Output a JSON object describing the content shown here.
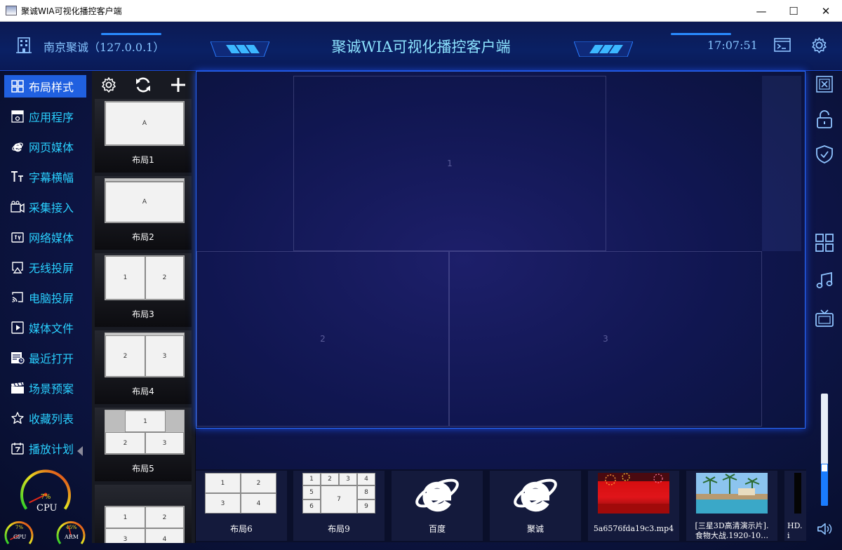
{
  "window": {
    "title": "聚诚WIA可视化播控客户端",
    "minimize": "—",
    "maximize": "☐",
    "close": "✕"
  },
  "header": {
    "company": "南京聚诚（127.0.0.1）",
    "title": "聚诚WIA可视化播控客户端",
    "clock": "17:07:51"
  },
  "nav": {
    "items": [
      {
        "label": "布局样式",
        "icon": "grid-icon",
        "active": true
      },
      {
        "label": "应用程序",
        "icon": "exe-icon"
      },
      {
        "label": "网页媒体",
        "icon": "ie-icon"
      },
      {
        "label": "字幕横幅",
        "icon": "text-icon"
      },
      {
        "label": "采集接入",
        "icon": "camera-icon"
      },
      {
        "label": "网络媒体",
        "icon": "tv-icon"
      },
      {
        "label": "无线投屏",
        "icon": "airplay-icon"
      },
      {
        "label": "电脑投屏",
        "icon": "cast-icon"
      },
      {
        "label": "媒体文件",
        "icon": "play-file-icon"
      },
      {
        "label": "最近打开",
        "icon": "recent-icon"
      },
      {
        "label": "场景预案",
        "icon": "clapper-icon"
      },
      {
        "label": "收藏列表",
        "icon": "star-icon"
      },
      {
        "label": "播放计划",
        "icon": "calendar-icon"
      }
    ]
  },
  "layouts": {
    "items": [
      {
        "label": "布局1",
        "cells": [
          "A"
        ]
      },
      {
        "label": "布局2",
        "cells": [
          "A"
        ]
      },
      {
        "label": "布局3",
        "cells": [
          "1",
          "2"
        ]
      },
      {
        "label": "布局4",
        "cells": [
          "2",
          "3"
        ]
      },
      {
        "label": "布局5",
        "cells": [
          "1",
          "2",
          "3"
        ]
      },
      {
        "label": "",
        "cells": [
          "1",
          "2",
          "3",
          "4"
        ]
      }
    ]
  },
  "canvas": {
    "regions": [
      "1",
      "2",
      "3"
    ]
  },
  "media_strip": {
    "items": [
      {
        "label": "布局6",
        "kind": "layout",
        "cells": [
          "1",
          "2",
          "3",
          "4"
        ]
      },
      {
        "label": "布局9",
        "kind": "layout",
        "cells": [
          "1",
          "2",
          "3",
          "4",
          "5",
          "7",
          "8",
          "6",
          "9"
        ]
      },
      {
        "label": "百度",
        "kind": "web"
      },
      {
        "label": "聚诚",
        "kind": "web"
      },
      {
        "label": "5a6576fda19c3.mp4",
        "kind": "video-red"
      },
      {
        "label": "[三星3D高清演示片].\n食物大战.1920-10…",
        "kind": "video-resort"
      },
      {
        "label": "HD.\ni",
        "kind": "video-dark"
      }
    ]
  },
  "gauges": {
    "cpu_label": "CPU",
    "cpu_value": "7%",
    "cpu_level": 0.07,
    "gpu_label": "GPU",
    "gpu_value": "7%",
    "gpu_level": 0.07,
    "arm_label": "ARM",
    "arm_value": "45%",
    "arm_level": 0.45
  },
  "volume": {
    "level": 0.34
  },
  "colors": {
    "accent": "#2060e0",
    "nav_text": "#2ad0ff",
    "title_text": "#8de4ff"
  }
}
